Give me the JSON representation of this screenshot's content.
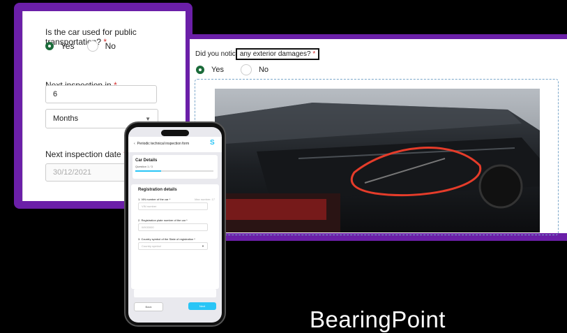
{
  "form_left": {
    "public_transport_question": "Is the car used for public transportation?",
    "required_marker": "*",
    "yes_label": "Yes",
    "no_label": "No",
    "next_inspection_label": "Next inspection in",
    "next_inspection_value": "6",
    "unit_value": "Months",
    "next_inspection_date_label": "Next inspection date",
    "next_inspection_date_value": "30/12/2021"
  },
  "form_right": {
    "damages_question_prefix": "Did you notic",
    "damages_question_highlight": "any exterior damages?",
    "required_marker": "*",
    "yes_label": "Yes",
    "no_label": "No"
  },
  "phone": {
    "header_title": "Periodic technical inspection form",
    "logo": "S",
    "section_title": "Car Details",
    "question_counter": "Question 1 / 3",
    "progress": 0.33,
    "card_title": "Registration details",
    "field1_label": "1. VIN number of the car *",
    "field1_hint": "Max number: 17",
    "field1_placeholder": "VIN number",
    "field2_label": "2. Registration plate number of the car *",
    "field2_placeholder": "WX00000",
    "field3_label": "3. Country symbol of the State of registration *",
    "field3_placeholder": "Country symbol",
    "back_label": "Back",
    "next_label": "Next"
  },
  "brand": "BearingPoint",
  "colors": {
    "purple": "#6b1fa8",
    "green": "#1b6b3a",
    "cyan": "#29c5f6",
    "required": "#d32f2f"
  }
}
